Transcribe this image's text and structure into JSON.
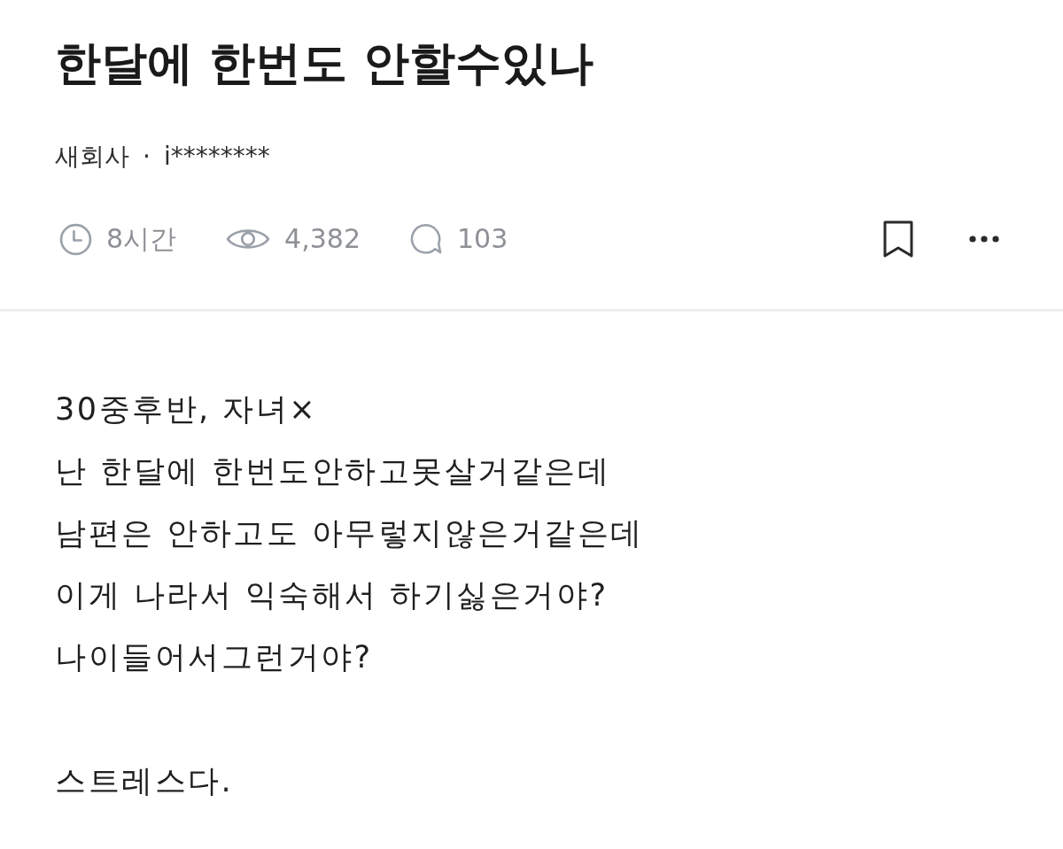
{
  "post": {
    "title": "한달에 한번도 안할수있나",
    "author": {
      "company": "새회사",
      "separator": "·",
      "nickname": "i********"
    },
    "stats": [
      {
        "kind": "time",
        "text": "8시간"
      },
      {
        "kind": "views",
        "text": "4,382"
      },
      {
        "kind": "comments",
        "text": "103"
      }
    ],
    "body": [
      "30중후반, 자녀×\n난 한달에 한번도안하고못살거같은데\n남편은 안하고도 아무렇지않은거같은데\n이게 나라서 익숙해서 하기싫은거야?\n나이들어서그런거야?",
      "스트레스다."
    ]
  }
}
